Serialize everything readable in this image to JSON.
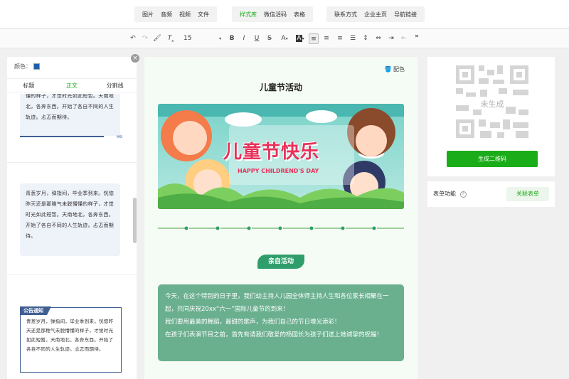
{
  "topbar": {
    "group1": [
      "图片",
      "音频",
      "视频",
      "文件"
    ],
    "group2": [
      "样式库",
      "微信活码",
      "表格"
    ],
    "group2_active": "样式库",
    "group3": [
      "联系方式",
      "企业主页",
      "导航链接"
    ]
  },
  "toolbar": {
    "font_size": "15"
  },
  "left_panel": {
    "color_label": "颜色：",
    "color_value": "#1f5fa8",
    "tabs": [
      "标题",
      "正文",
      "分割线"
    ],
    "active_tab": "正文",
    "card1_text": "懂的样子，才觉时光如此短暂。天南地北，各奔东西。开始了各自不同的人生轨迹。忐忑而期待。",
    "card2_text": "青葱岁月，弹指间，毕业季到来。恍惚昨天还是那稚气未脱懵懂的样子，才觉时光如此短暂。天南地北，各奔东西。开始了各自不同的人生轨迹。忐忑而期待。",
    "card3_label": "公告通知",
    "card3_text": "青葱岁月，弹指间，毕业季到来。恍惚昨天还是那稚气未脱懵懂的样子，才觉时光如此短暂。天南地北，各奔东西。开始了各自不同的人生轨迹。忐忑而期待。"
  },
  "editor": {
    "color_button": "配色",
    "title": "儿童节活动",
    "banner_title": "儿童节快乐",
    "banner_subtitle": "HAPPY CHILDREND'S DAY",
    "section_label": "亲自活动",
    "paragraphs": [
      "今天，在这个特别的日子里，我们幼主持人儿园全体师主持人生和各位家长相聚在一起，共同庆祝20xx“六一”国际儿童节的到来！",
      "我们要用最美的舞蹈，最甜的歌声，为我们自己的节日增光添彩！",
      "在孩子们表演节目之前，首先有请我们敬爱的杨园长为孩子们送上她诚挚的祝福！"
    ],
    "textbox_color": "#6aaf8e"
  },
  "right_panel": {
    "qr_status": "未生成",
    "generate_button": "生成二维码",
    "form_label": "表单功能",
    "form_link_button": "关联表单"
  },
  "colors": {
    "accent": "#1aad19",
    "template_blue": "#3f5e92"
  }
}
